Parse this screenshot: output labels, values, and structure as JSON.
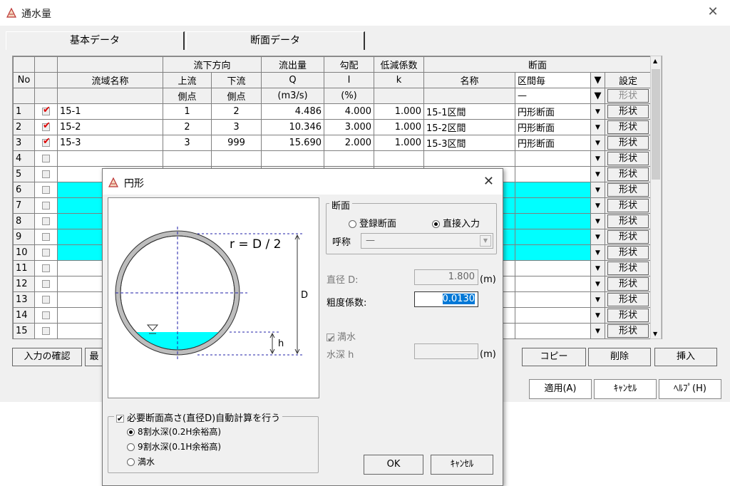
{
  "window": {
    "title": "通水量"
  },
  "tabs": [
    "基本データ",
    "断面データ"
  ],
  "headers": {
    "row1": {
      "no": "No",
      "flow_dir": "流下方向",
      "discharge": "流出量",
      "slope": "勾配",
      "reduction": "低減係数",
      "section": "断面"
    },
    "row2": {
      "basin_name": "流域名称",
      "upstream": "上流",
      "downstream": "下流",
      "q": "Q",
      "i": "I",
      "k": "k",
      "name": "名称",
      "section_mode": "区間毎",
      "setting": "設定"
    },
    "row3": {
      "up_point": "側点",
      "down_point": "側点",
      "q_unit": "(m3/s)",
      "i_unit": "(%)",
      "mode_value": "—",
      "shape": "形状"
    }
  },
  "rows": [
    {
      "no": "1",
      "checked": true,
      "name": "15-1",
      "up": "1",
      "down": "2",
      "q": "4.486",
      "i": "4.000",
      "k": "1.000",
      "sec_name": "15-1区間",
      "sec_type": "円形断面",
      "shape": "形状"
    },
    {
      "no": "2",
      "checked": true,
      "name": "15-2",
      "up": "2",
      "down": "3",
      "q": "10.346",
      "i": "3.000",
      "k": "1.000",
      "sec_name": "15-2区間",
      "sec_type": "円形断面",
      "shape": "形状"
    },
    {
      "no": "3",
      "checked": true,
      "name": "15-3",
      "up": "3",
      "down": "999",
      "q": "15.690",
      "i": "2.000",
      "k": "1.000",
      "sec_name": "15-3区間",
      "sec_type": "円形断面",
      "shape": "形状"
    },
    {
      "no": "4",
      "shape": "形状"
    },
    {
      "no": "5",
      "shape": "形状"
    },
    {
      "no": "6",
      "shape": "形状"
    },
    {
      "no": "7",
      "shape": "形状"
    },
    {
      "no": "8",
      "shape": "形状"
    },
    {
      "no": "9",
      "shape": "形状"
    },
    {
      "no": "10",
      "shape": "形状"
    },
    {
      "no": "11",
      "shape": "形状"
    },
    {
      "no": "12",
      "shape": "形状"
    },
    {
      "no": "13",
      "shape": "形状"
    },
    {
      "no": "14",
      "shape": "形状"
    },
    {
      "no": "15",
      "shape": "形状"
    }
  ],
  "buttons": {
    "confirm": "入力の確認",
    "partial": "最",
    "copy": "コピー",
    "delete": "削除",
    "insert": "挿入",
    "apply": "適用(A)",
    "cancel": "ｷｬﾝｾﾙ",
    "help": "ﾍﾙﾌﾟ(H)"
  },
  "dialog": {
    "title": "円形",
    "formula": "r = D / 2",
    "label_d": "D",
    "label_h": "h",
    "section_group": "断面",
    "radio_registered": "登録断面",
    "radio_direct": "直接入力",
    "name_label": "呼称",
    "name_value": "—",
    "diameter_label": "直径 D:",
    "diameter_value": "1.800",
    "unit_m": "(m)",
    "roughness_label": "粗度係数:",
    "roughness_value": "0.0130",
    "full_label": "満水",
    "depth_label": "水深 h",
    "auto_label": "必要断面高さ(直径D)自動計算を行う",
    "opt1": "8割水深(0.2H余裕高)",
    "opt2": "9割水深(0.1H余裕高)",
    "opt3": "満水",
    "ok": "OK",
    "cancel": "ｷｬﾝｾﾙ"
  },
  "colors": {
    "highlight": "#00ffff",
    "water": "#00ffff",
    "pipe": "#bdbdbd",
    "accent_red": "#dd0000"
  }
}
